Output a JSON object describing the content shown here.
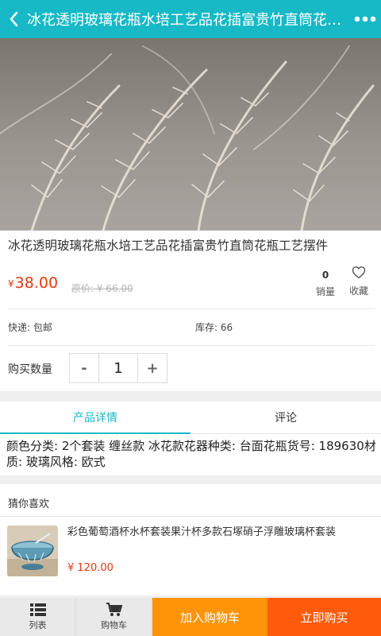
{
  "header": {
    "title": "冰花透明玻璃花瓶水培工艺品花插富贵竹直筒花瓶工艺摆件",
    "back_icon": "back-arrow-icon",
    "menu_icon": "more-dots-icon"
  },
  "product": {
    "title": "冰花透明玻璃花瓶水培工艺品花插富贵竹直筒花瓶工艺摆件",
    "currency": "¥",
    "price": "38.00",
    "original_price": "原价: ¥ 66.00",
    "sales_count": "0",
    "sales_label": "销量",
    "favorite_label": "收藏",
    "shipping": "快递: 包邮",
    "stock": "库存: 66",
    "quantity_label": "购买数量",
    "quantity": "1",
    "minus_label": "-",
    "plus_label": "+"
  },
  "tabs": [
    {
      "label": "产品详情",
      "active": true
    },
    {
      "label": "评论",
      "active": false
    }
  ],
  "detail": {
    "text": "颜色分类: 2个套装 缠丝款 冰花款花器种类: 台面花瓶货号: 189630材质: 玻璃风格: 欧式"
  },
  "recommend": {
    "heading": "猜你喜欢",
    "items": [
      {
        "name": "彩色葡萄酒杯水杯套装果汁杯多款石塚硝子浮雕玻璃杯套装",
        "price": "¥ 120.00"
      }
    ]
  },
  "bottom": {
    "list_label": "列表",
    "cart_label": "购物车",
    "add_cart_label": "加入购物车",
    "buy_label": "立即购买"
  },
  "colors": {
    "accent": "#16b9c5",
    "price": "#e8380d",
    "add_cart": "#ff9409",
    "buy": "#ff5b0a"
  }
}
